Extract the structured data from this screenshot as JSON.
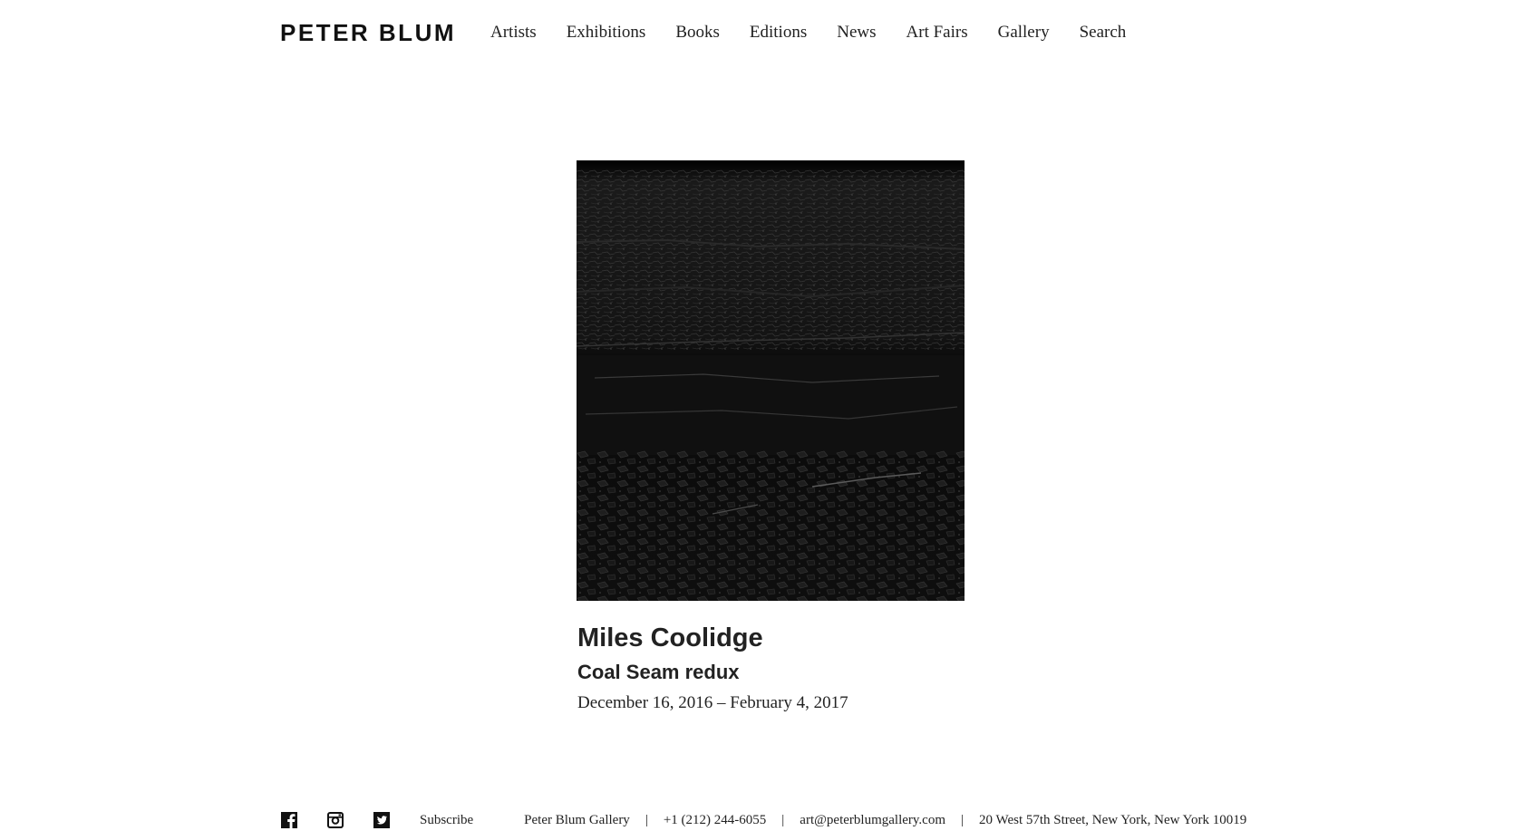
{
  "header": {
    "logo": "PETER BLUM",
    "nav": [
      {
        "label": "Artists",
        "name": "nav-artists"
      },
      {
        "label": "Exhibitions",
        "name": "nav-exhibitions"
      },
      {
        "label": "Books",
        "name": "nav-books"
      },
      {
        "label": "Editions",
        "name": "nav-editions"
      },
      {
        "label": "News",
        "name": "nav-news"
      },
      {
        "label": "Art Fairs",
        "name": "nav-art-fairs"
      },
      {
        "label": "Gallery",
        "name": "nav-gallery"
      },
      {
        "label": "Search",
        "name": "nav-search"
      }
    ]
  },
  "exhibition": {
    "artist": "Miles Coolidge",
    "title": "Coal Seam redux",
    "dates": "December 16, 2016 – February 4, 2017"
  },
  "footer": {
    "social_icons": [
      "facebook-icon",
      "instagram-icon",
      "twitter-icon"
    ],
    "subscribe": "Subscribe",
    "gallery_name": "Peter Blum Gallery",
    "phone": "+1 (212) 244-6055",
    "email": "art@peterblumgallery.com",
    "address": "20 West 57th Street, New York, New York 10019",
    "separator": "|"
  }
}
